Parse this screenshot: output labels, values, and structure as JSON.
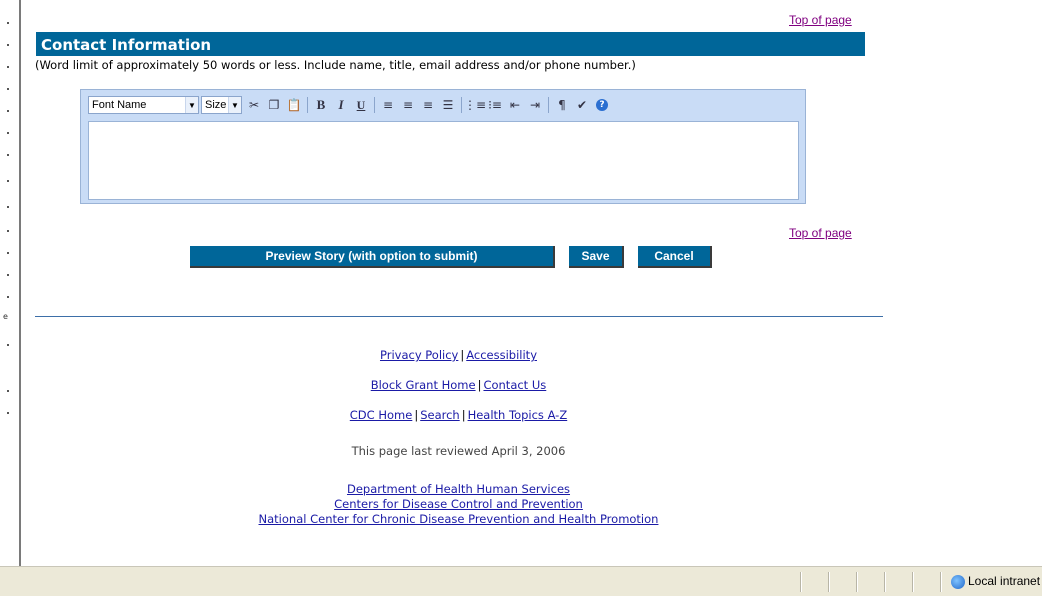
{
  "section": {
    "title": "Contact Information",
    "hint": "(Word limit of approximately 50 words or less. Include name, title, email address and/or phone number.)"
  },
  "top_of_page": "Top of page",
  "editor": {
    "font_name_label": "Font Name",
    "size_label": "Size",
    "bold_glyph": "B",
    "italic_glyph": "I",
    "underline_glyph": "U",
    "help_glyph": "?",
    "icons": [
      "cut-icon",
      "copy-icon",
      "paste-icon",
      "bold-icon",
      "italic-icon",
      "underline-icon",
      "align-left-icon",
      "align-center-icon",
      "align-right-icon",
      "justify-icon",
      "numbered-list-icon",
      "bulleted-list-icon",
      "outdent-icon",
      "indent-icon",
      "paragraph-icon",
      "spellcheck-icon",
      "help-icon"
    ],
    "content": ""
  },
  "buttons": {
    "preview": "Preview Story (with option to submit)",
    "save": "Save",
    "cancel": "Cancel"
  },
  "footer": {
    "privacy": "Privacy Policy",
    "accessibility": "Accessibility",
    "block_grant_home": "Block Grant Home",
    "contact_us": "Contact Us",
    "cdc_home": "CDC Home",
    "search": "Search",
    "health_topics": "Health Topics A-Z",
    "separator": "|",
    "reviewed": "This page last reviewed April 3, 2006",
    "dept_hhs": "Department of Health Human Services",
    "cdc": "Centers for Disease Control and Prevention",
    "nccdphp": "National Center for Chronic Disease Prevention and Health Promotion"
  },
  "statusbar": {
    "zone": "Local intranet"
  },
  "colors": {
    "header_blue": "#006699",
    "link": "#1a1aa6",
    "visited_link": "#800080",
    "toolbar_bg": "#c9dcf6",
    "statusbar_bg": "#ece9d8"
  }
}
